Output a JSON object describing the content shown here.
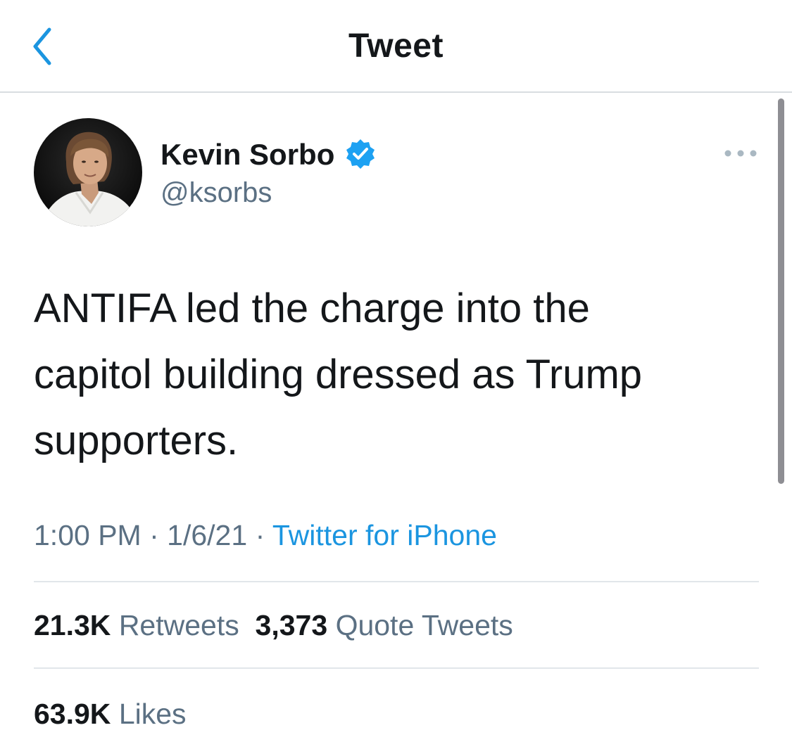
{
  "nav": {
    "title": "Tweet"
  },
  "tweet": {
    "author": {
      "name": "Kevin Sorbo",
      "handle": "@ksorbs",
      "verified": true
    },
    "lines": [
      "ANTIFA led the charge into the",
      "capitol building dressed as Trump",
      "supporters."
    ],
    "time": "1:00 PM",
    "date": "1/6/21",
    "separator": "·",
    "source": "Twitter for iPhone",
    "retweets": {
      "count": "21.3K",
      "label": "Retweets"
    },
    "quotes": {
      "count": "3,373",
      "label": "Quote Tweets"
    },
    "likes": {
      "count": "63.9K",
      "label": "Likes"
    }
  },
  "colors": {
    "accent": "#1b95e0",
    "secondary_text": "#5b7083",
    "primary_text": "#14171a",
    "divider": "#e1e6ea"
  },
  "icons": {
    "back": "chevron-left-icon",
    "verified": "verified-badge-icon",
    "more": "more-horizontal-icon"
  }
}
